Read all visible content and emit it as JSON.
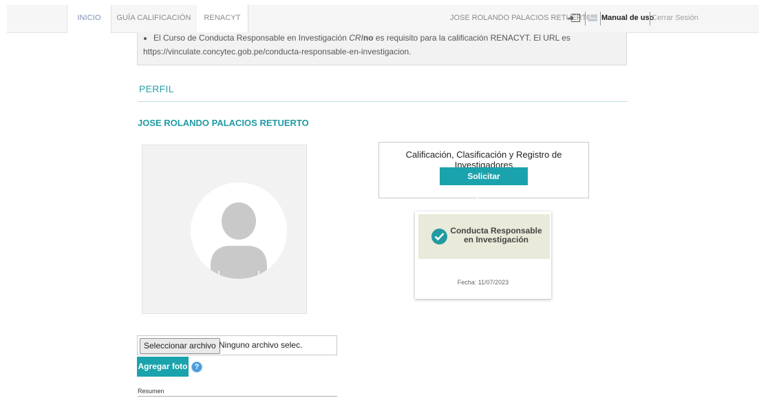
{
  "nav": {
    "tabs": [
      {
        "label": "INICIO"
      },
      {
        "label": "GUÍA CALIFICACIÓN"
      },
      {
        "label": "RENACYT"
      }
    ],
    "user_name": "JOSE ROLANDO PALACIOS RETUERTO",
    "manual_label": "Manual de uso",
    "logout_label": "Cerrar Sesión"
  },
  "info": {
    "line1_prefix": "El Curso de Conducta Responsable en Investigación ",
    "line1_cri": "CRI",
    "line1_no": "no",
    "line1_suffix": " es requisito para la calificación RENACYT. El URL es",
    "line2": "https://vinculate.concytec.gob.pe/conducta-responsable-en-investigacion."
  },
  "profile": {
    "section_title": "PERFIL",
    "name": "JOSE ROLANDO PALACIOS RETUERTO"
  },
  "calificacion": {
    "title": "Calificación, Clasificación y Registro de Investigadores",
    "button": "Solicitar Incorporación"
  },
  "cri_badge": {
    "line1": "Conducta Responsable",
    "line2": "en Investigación",
    "date": "Fecha: 11/07/2023"
  },
  "upload": {
    "choose_button": "Seleccionar archivo",
    "status": "Ninguno archivo selec.",
    "add_button": "Agregar foto",
    "help": "?"
  },
  "resumen_label": "Resumen",
  "colors": {
    "accent": "#1aa3ac",
    "title_teal": "#2aa0a8",
    "badge_bg": "#eaeada"
  }
}
